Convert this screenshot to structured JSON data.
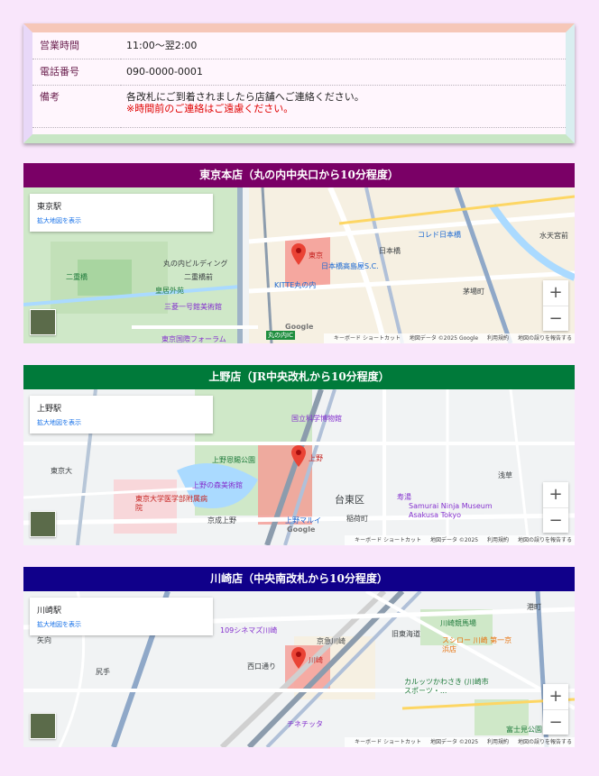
{
  "info": {
    "rows": [
      {
        "label": "営業時間",
        "value": "11:00〜翌2:00"
      },
      {
        "label": "電話番号",
        "value": "090-0000-0001"
      },
      {
        "label": "備考",
        "value": "各改札にご到着されましたら店舗へご連絡ください。",
        "note": "※時間前のご連絡はご遠慮ください。"
      }
    ]
  },
  "stores": [
    {
      "title": "東京本店（丸の内中央口から10分程度）",
      "color": "#7a0066",
      "place": "東京駅",
      "link": "拡大地図を表示",
      "labels": [
        "東京",
        "日本橋高島屋S.C.",
        "KITTE丸の内",
        "丸の内ビルディング",
        "二重橋前",
        "皇居外苑",
        "三菱一号館美術館",
        "東京国際フォーラム",
        "コレド日本橋",
        "日本橋",
        "茅場町",
        "水天宮前",
        "二重橋",
        "丸の内IC"
      ]
    },
    {
      "title": "上野店（JR中央改札から10分程度）",
      "color": "#007a3a",
      "place": "上野駅",
      "link": "拡大地図を表示",
      "labels": [
        "上野",
        "国立科学博物館",
        "上野恩賜公園",
        "上野の森美術館",
        "東京大学医学部附属病院",
        "台東区",
        "上野マルイ",
        "京成上野",
        "寿湯",
        "Samurai Ninja Museum Asakusa Tokyo",
        "稲荷町",
        "東京大",
        "浅草"
      ]
    },
    {
      "title": "川崎店（中央南改札から10分程度）",
      "color": "#10008a",
      "place": "川崎駅",
      "link": "拡大地図を表示",
      "labels": [
        "川崎",
        "109シネマズ川崎",
        "京急川崎",
        "西口通り",
        "チネチッタ",
        "川崎競馬場",
        "スシロー 川崎 第一京浜店",
        "カルッツかわさき (川崎市スポーツ・...",
        "富士見公園",
        "尻手",
        "港町",
        "矢向",
        "旧東海道"
      ]
    }
  ],
  "map_ui": {
    "zoom_in": "+",
    "zoom_out": "−",
    "attribution": [
      "キーボード ショートカット",
      "地図データ ©2025 Google",
      "利用規約",
      "地図の誤りを報告する"
    ],
    "attribution_short": [
      "キーボード ショートカット",
      "地図データ ©2025",
      "利用規約",
      "地図の誤りを報告する"
    ],
    "google": "Google"
  }
}
